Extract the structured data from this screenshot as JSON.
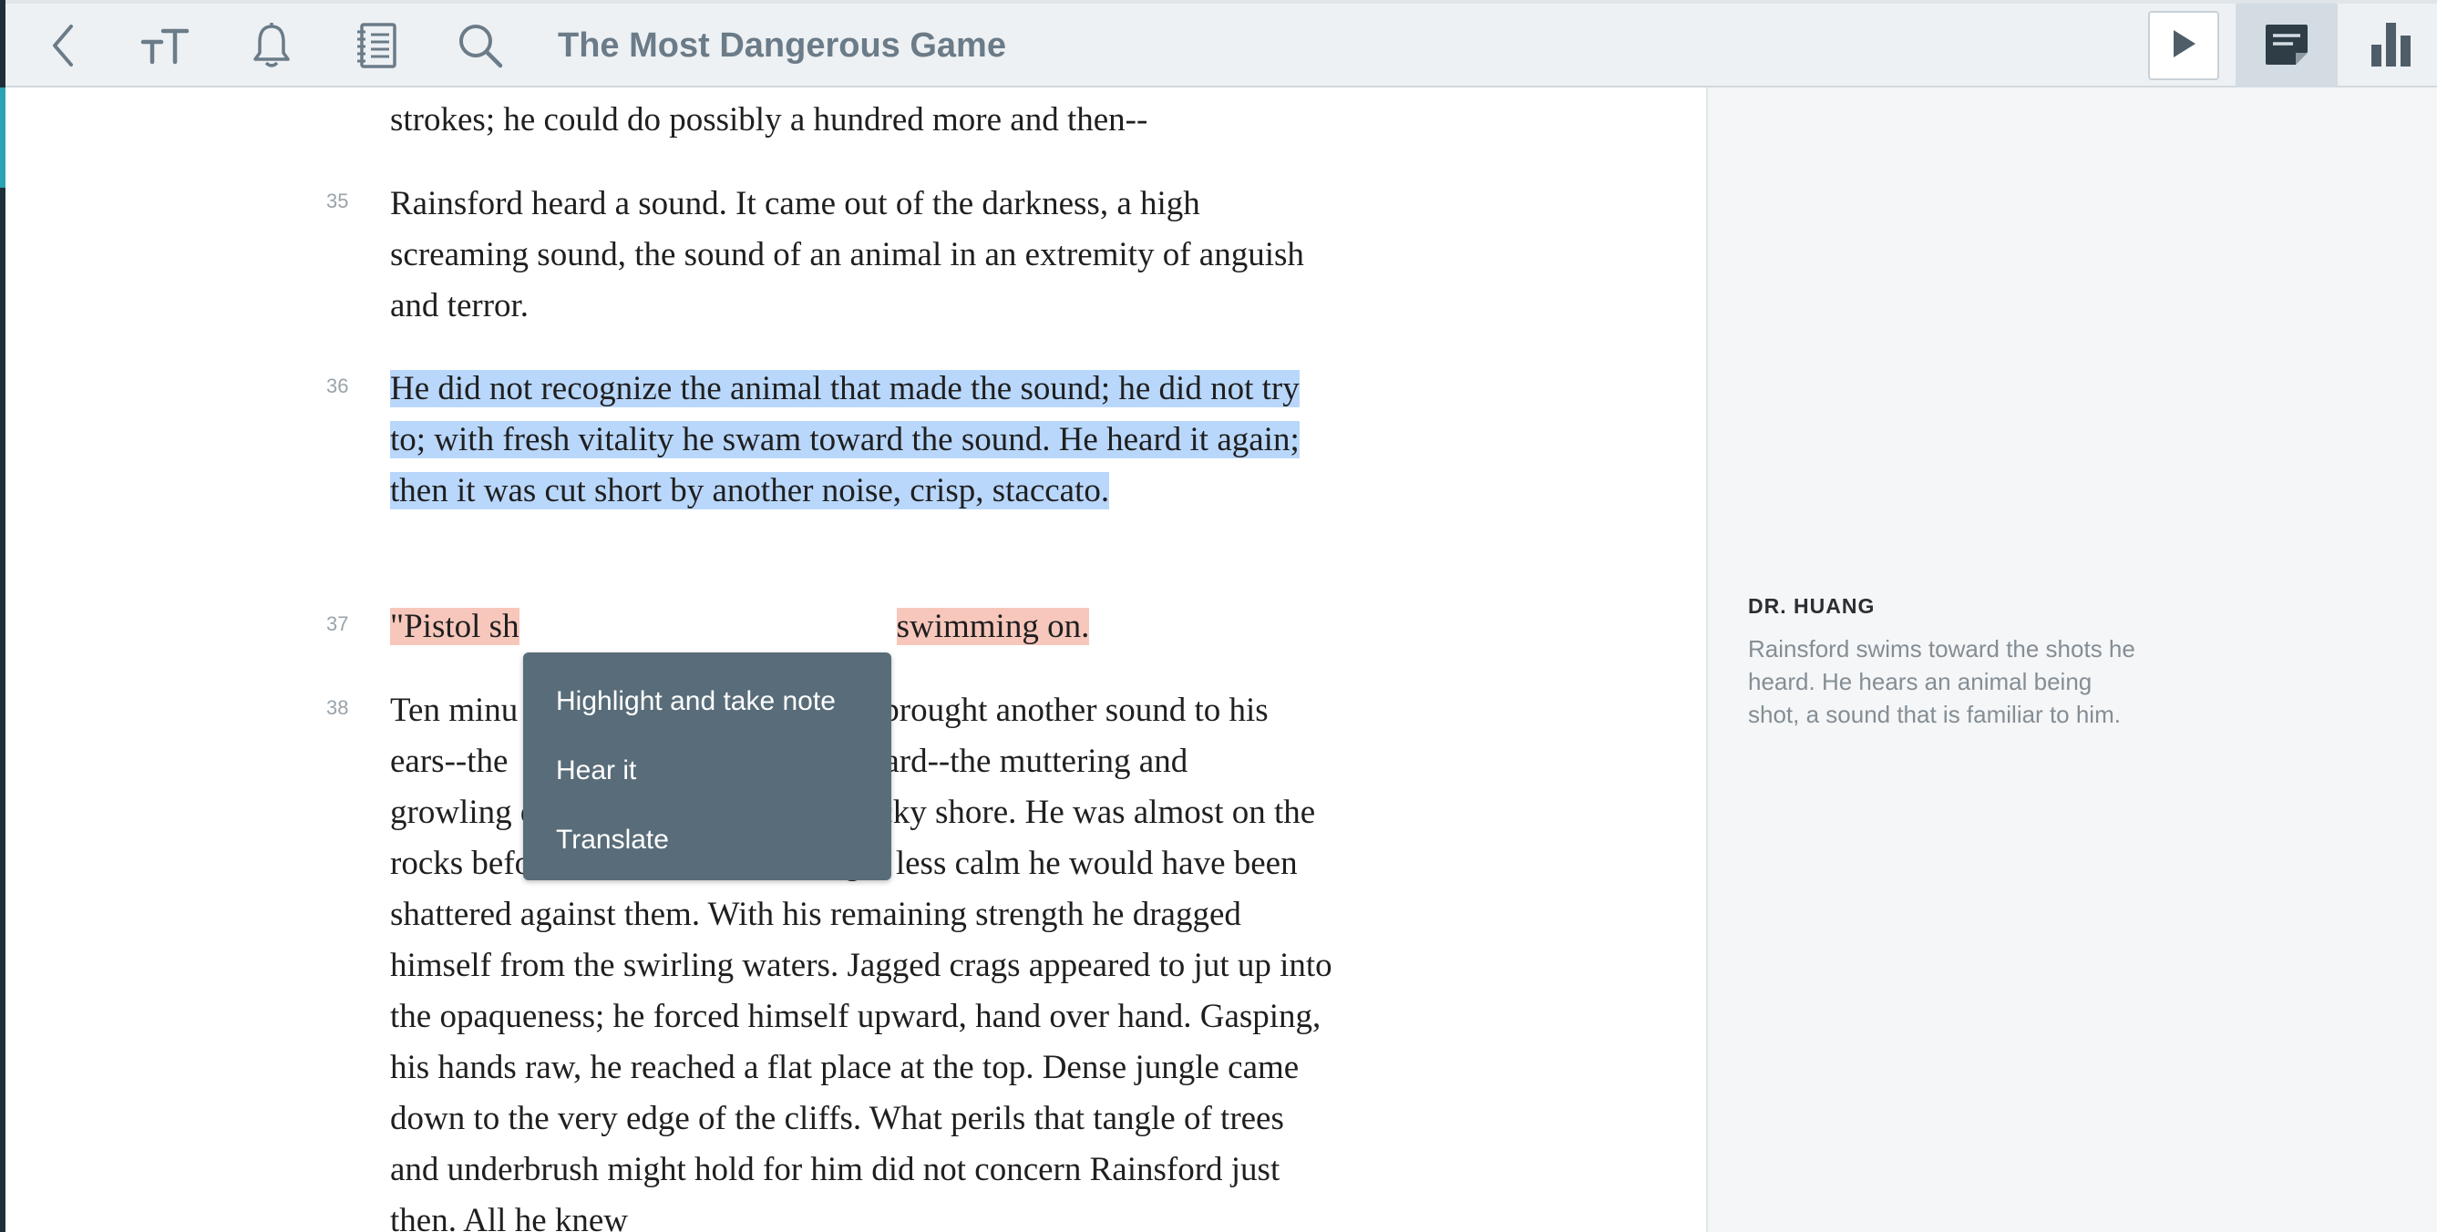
{
  "toolbar": {
    "title": "The Most Dangerous Game",
    "icons": [
      "back-chevron-icon",
      "text-size-icon",
      "bell-icon",
      "notebook-icon",
      "search-icon",
      "play-icon",
      "notes-icon",
      "bar-chart-icon"
    ]
  },
  "reader": {
    "paragraphs": [
      {
        "number": "",
        "text": "strokes; he could do possibly a hundred more and then--"
      },
      {
        "number": "35",
        "text": "Rainsford heard a sound. It came out of the darkness, a high screaming sound, the sound of an animal in an extremity of anguish and terror."
      },
      {
        "number": "36",
        "text": "He did not recognize the animal that made the sound; he did not try to; with fresh vitality he swam toward the sound. He heard it again; then it was cut short by another noise, crisp, staccato.",
        "highlight": "blue"
      },
      {
        "number": "37",
        "text_start": "\"Pistol sh",
        "text_end": "swimming on.",
        "highlight": "salmon"
      },
      {
        "number": "38",
        "line1_start": "Ten minu",
        "line1_end": "brought another sound to his",
        "line2_start": "ears--the",
        "line2_end": "er heard--the muttering and",
        "text_rest": "growling of the sea breaking on a rocky shore. He was almost on the rocks before he saw them; on a night less calm he would have been shattered against them. With his remaining strength he dragged himself from the swirling waters. Jagged crags appeared to jut up into the opaqueness; he forced himself upward, hand over hand. Gasping, his hands raw, he reached a flat place at the top. Dense jungle came down to the very edge of the cliffs. What perils that tangle of trees and underbrush might hold for him did not concern Rainsford just then. All he knew"
      }
    ]
  },
  "popup": {
    "items": [
      "Highlight and take note",
      "Hear it",
      "Translate"
    ]
  },
  "sidebar": {
    "note_author": "DR. HUANG",
    "note_text": "Rainsford swims toward the shots he heard. He hears an animal being shot, a sound that is familiar to him."
  },
  "colors": {
    "highlight_blue": "#b9d7fb",
    "highlight_salmon": "#f7c7bc",
    "popup_bg": "#586c79",
    "toolbar_bg": "#edf1f4"
  }
}
